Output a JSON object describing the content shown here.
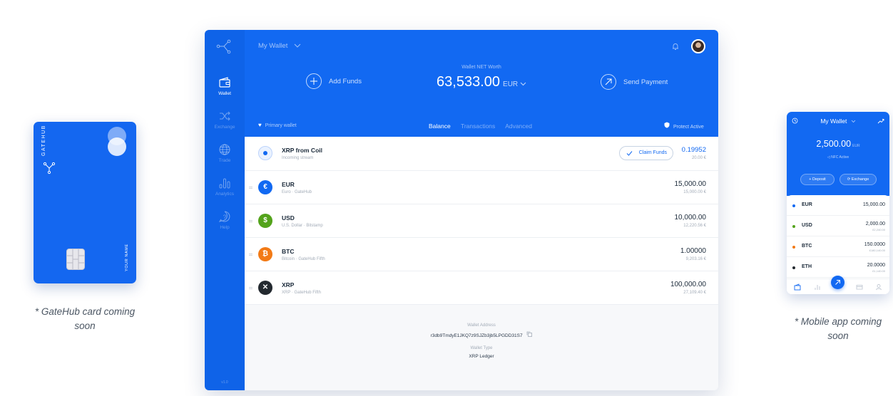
{
  "card": {
    "brand": "GATEHUB",
    "holder": "YOUR NAME",
    "caption": "* GateHub card coming soon"
  },
  "mobile_caption": "* Mobile app coming soon",
  "desktop": {
    "sidebar": {
      "items": [
        {
          "label": "Wallet",
          "icon": "wallet-icon",
          "active": true
        },
        {
          "label": "Exchange",
          "icon": "shuffle-icon",
          "active": false
        },
        {
          "label": "Trade",
          "icon": "globe-icon",
          "active": false
        },
        {
          "label": "Analytics",
          "icon": "analytics-icon",
          "active": false
        },
        {
          "label": "Help",
          "icon": "help-icon",
          "active": false
        }
      ],
      "version": "v1.0"
    },
    "header": {
      "wallet_selector": "My Wallet",
      "add_funds": "Add Funds",
      "net_worth_label": "Wallet NET Worth",
      "net_worth_value": "63,533.00",
      "net_worth_currency": "EUR",
      "send_payment": "Send Payment",
      "primary_wallet": "Primary wallet",
      "tabs": [
        "Balance",
        "Transactions",
        "Advanced"
      ],
      "active_tab": "Balance",
      "protect": "Protect Active"
    },
    "coil": {
      "name": "XRP from Coil",
      "sub": "Incoming stream",
      "claim_label": "Claim Funds",
      "amount": "0.19952",
      "fiat": "20.00 €"
    },
    "balances": [
      {
        "name": "EUR",
        "sub": "Euro · GateHub",
        "amount": "15,000.00",
        "fiat": "15,000.00 €",
        "symbol": "€",
        "color": "#1269f2"
      },
      {
        "name": "USD",
        "sub": "U.S. Dollar · Bitstamp",
        "amount": "10,000.00",
        "fiat": "12,220.56 €",
        "symbol": "$",
        "color": "#53a31b"
      },
      {
        "name": "BTC",
        "sub": "Bitcoin · GateHub Fifth",
        "amount": "1.00000",
        "fiat": "9,203.16 €",
        "symbol": "₿",
        "color": "#f27a16"
      },
      {
        "name": "XRP",
        "sub": "XRP · GateHub Fifth",
        "amount": "100,000.00",
        "fiat": "27,109.40 €",
        "symbol": "✕",
        "color": "#23292f"
      }
    ],
    "footer": {
      "address_label": "Wallet Address",
      "address": "r3db9TmdyE1JKQ7z9SJZb3jb5LPGDD31S7",
      "type_label": "Wallet Type",
      "type": "XRP Ledger"
    }
  },
  "mobile": {
    "title": "My Wallet",
    "balance": "2,500.00",
    "currency": "EUR",
    "nfc": "NFC Active",
    "deposit": "Deposit",
    "exchange": "Exchange",
    "rows": [
      {
        "name": "EUR",
        "amount": "15,000.00",
        "fiat": "",
        "color": "#1269f2"
      },
      {
        "name": "USD",
        "amount": "2,000.00",
        "fiat": "£2,240.00",
        "color": "#53a31b"
      },
      {
        "name": "BTC",
        "amount": "150.0000",
        "fiat": "£180,140.00",
        "color": "#f27a16"
      },
      {
        "name": "ETH",
        "amount": "20.0000",
        "fiat": "£1,140.00",
        "color": "#23292f"
      }
    ]
  }
}
